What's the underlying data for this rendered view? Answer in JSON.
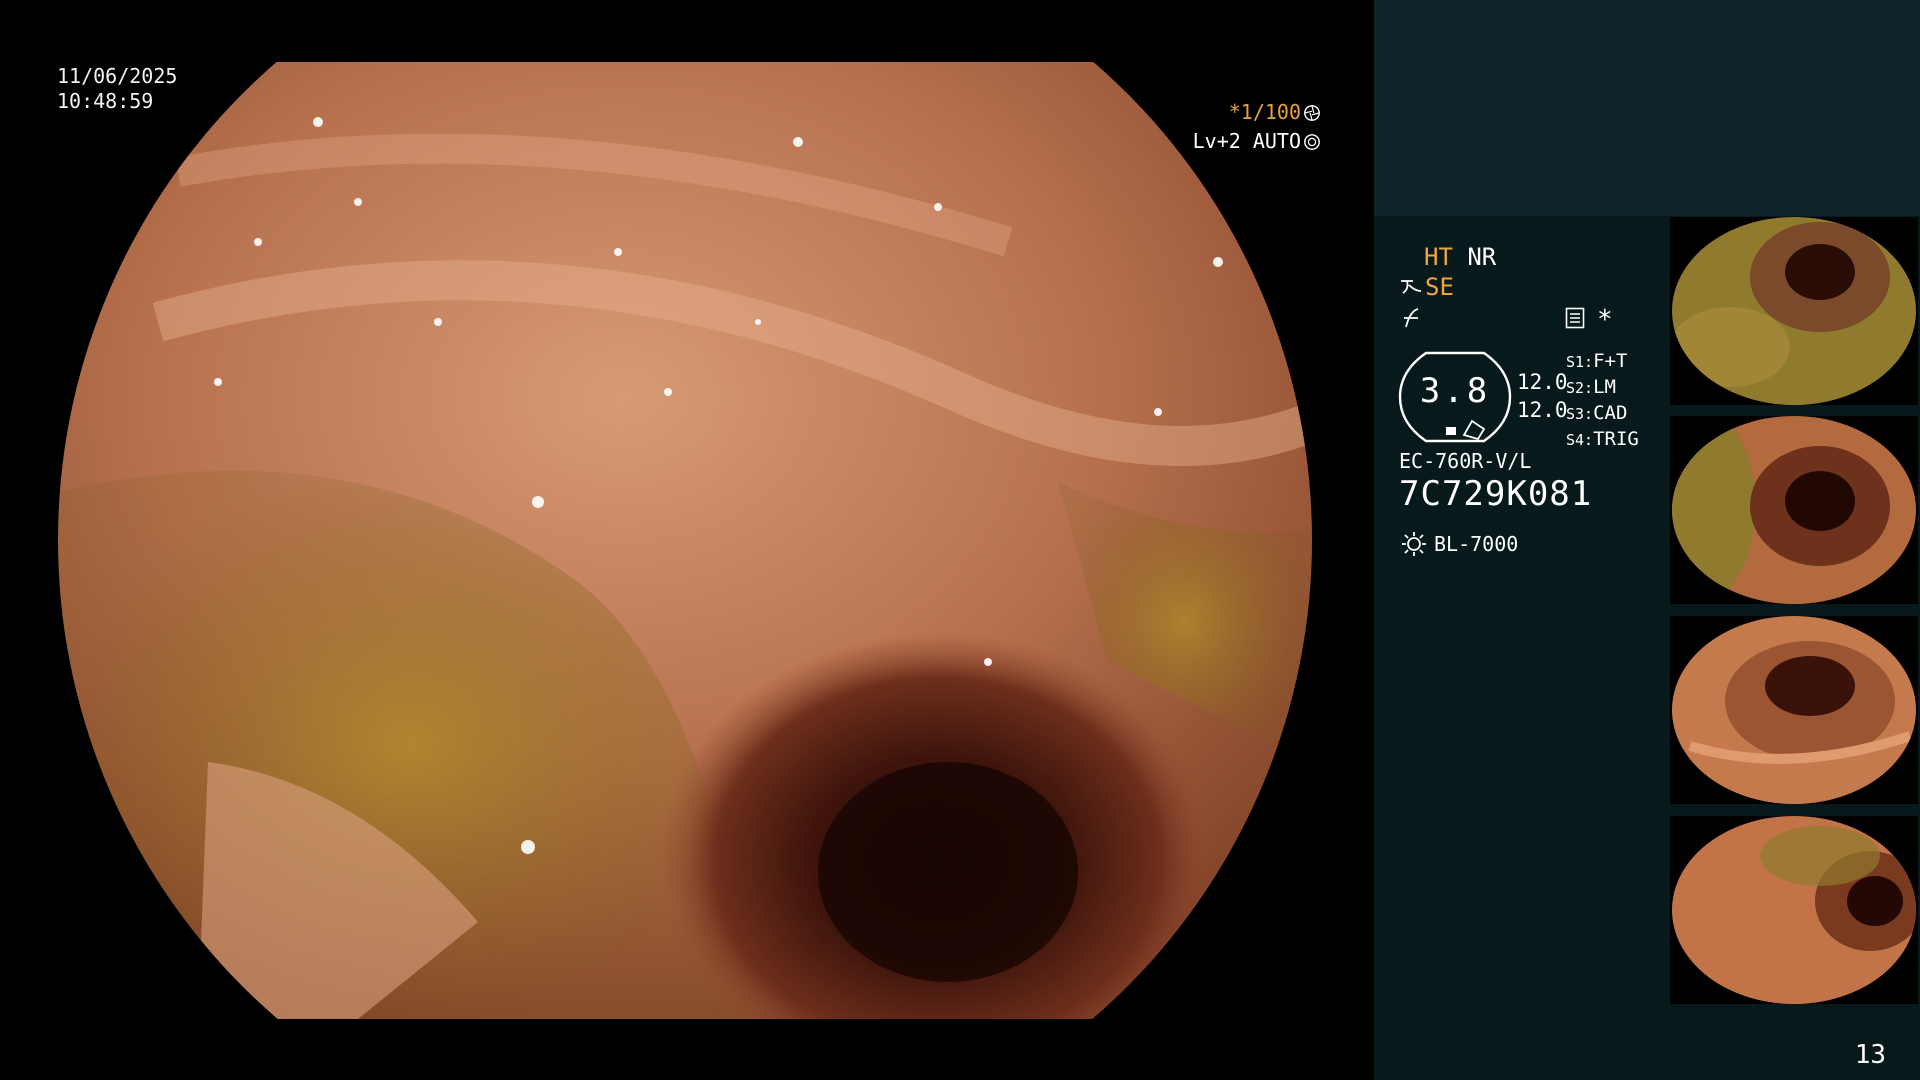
{
  "osd": {
    "date": "11/06/2025",
    "time": "10:48:59",
    "shutter": "*1/100",
    "level": "Lv+2 AUTO"
  },
  "side": {
    "ht": "HT",
    "nr": "NR",
    "se": "SE",
    "gauge_value": "3.8",
    "num_a": "12.0",
    "num_b": "12.0",
    "switches": [
      {
        "key": "S1:",
        "value": "F+T"
      },
      {
        "key": "S2:",
        "value": "LM"
      },
      {
        "key": "S3:",
        "value": "CAD"
      },
      {
        "key": "S4:",
        "value": "TRIG"
      }
    ],
    "scope_model": "EC-760R-V/L",
    "scope_serial": "7C729K081",
    "light_source": "BL-7000",
    "asterisk": "*",
    "page_number": "13"
  },
  "icons": {
    "shutter": "iris-icon",
    "auto": "aperture-icon",
    "se_symbol": "structure-enhance-icon",
    "f_symbol": "f-curve-icon",
    "memory": "memory-card-icon",
    "light": "lamp-icon"
  },
  "colors": {
    "osd_orange": "#f3a53a",
    "panel_dark": "#07191b",
    "panel_top": "#0e2629"
  },
  "thumbnails": [
    {
      "label": "capture-1"
    },
    {
      "label": "capture-2"
    },
    {
      "label": "capture-3"
    },
    {
      "label": "capture-4"
    }
  ]
}
